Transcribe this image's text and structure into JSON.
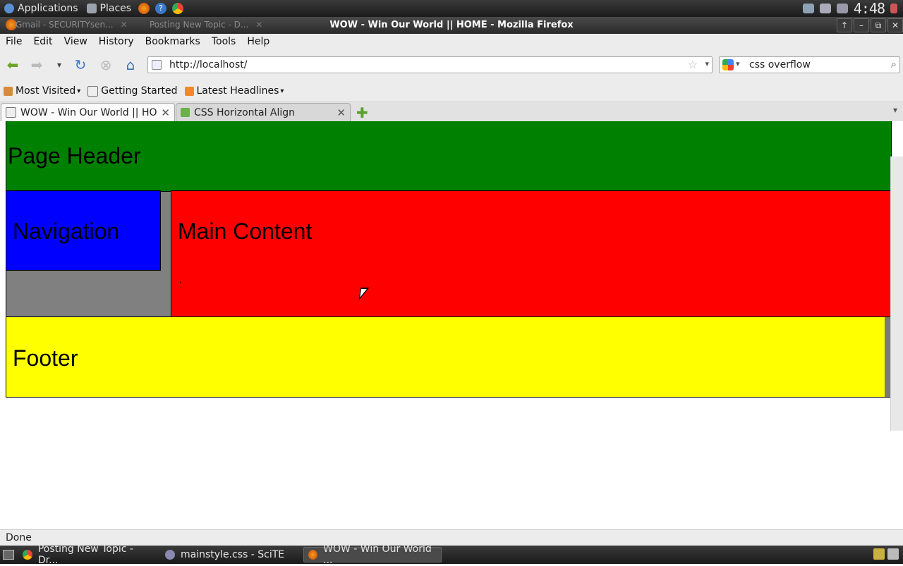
{
  "panel": {
    "applications": "Applications",
    "places": "Places",
    "launchers": [
      "firefox-icon",
      "help-icon",
      "chrome-icon"
    ],
    "clock": "4:48"
  },
  "window": {
    "title": "WOW - Win Our World || HOME - Mozilla Firefox",
    "background_tasks": [
      "Gmail - SECURITYsen...",
      "Posting New Topic - D..."
    ],
    "controls": [
      "↑",
      "–",
      "⧉",
      "✕"
    ]
  },
  "menu": [
    "File",
    "Edit",
    "View",
    "History",
    "Bookmarks",
    "Tools",
    "Help"
  ],
  "nav": {
    "url": "http://localhost/",
    "search_value": "css overflow"
  },
  "bookmarks": [
    "Most Visited",
    "Getting Started",
    "Latest Headlines"
  ],
  "tabs": [
    {
      "label": "WOW - Win Our World || HO...",
      "active": true
    },
    {
      "label": "CSS Horizontal Align",
      "active": false
    }
  ],
  "page": {
    "header": "Page Header",
    "navigation": "Navigation",
    "main": "Main Content",
    "main_dot": ".",
    "footer": "Footer",
    "colors": {
      "header": "#008000",
      "nav": "#0000ff",
      "main": "#ff0000",
      "footer": "#ffff00",
      "gutter": "#808080"
    }
  },
  "status": "Done",
  "taskbar": [
    {
      "label": "Posting New Topic - Dr...",
      "active": false
    },
    {
      "label": "mainstyle.css - SciTE",
      "active": false
    },
    {
      "label": "WOW - Win Our World ...",
      "active": true
    }
  ]
}
